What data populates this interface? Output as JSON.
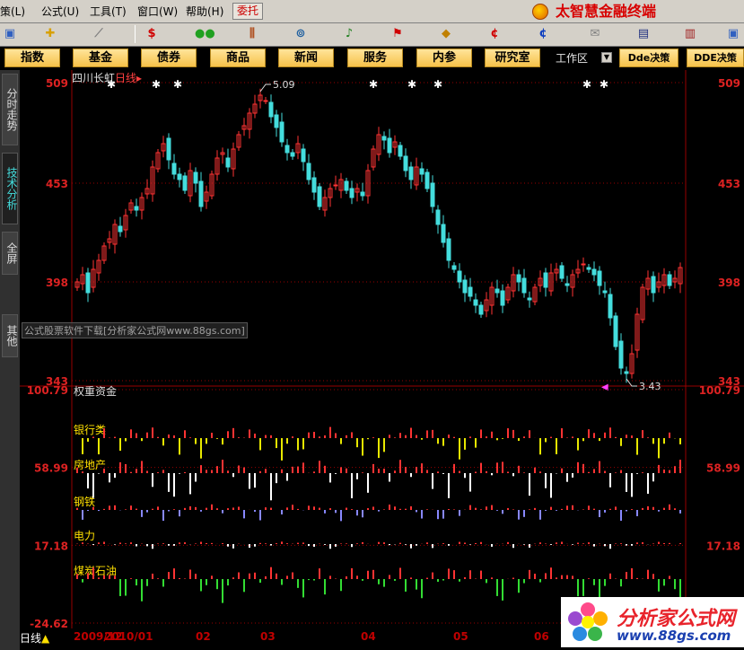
{
  "menubar": {
    "items": [
      "策(L)",
      "公式(U)",
      "工具(T)",
      "窗口(W)",
      "帮助(H)"
    ],
    "entrust": "委托",
    "brand": "太智慧金融终端"
  },
  "toolbar": {
    "icons": [
      "plus-icon",
      "ruler-icon",
      "dollar-icon",
      "traffic-light-icon",
      "bars-icon",
      "binoculars-icon",
      "bell-icon",
      "flag-icon",
      "diamond-icon",
      "red-coin-icon",
      "blue-coin-icon",
      "envelope-icon",
      "window-icon",
      "books-icon"
    ]
  },
  "nav": {
    "buttons": [
      "指数",
      "基金",
      "债券",
      "商品",
      "新闻",
      "服务",
      "内参",
      "研究室"
    ],
    "workarea": "工作区",
    "dde1": "Dde决策",
    "dde2": "DDE决策"
  },
  "sidebar": {
    "tabs": [
      "分时走势",
      "技术分析",
      "全屏",
      "其他"
    ]
  },
  "stock": {
    "name": "四川长虹",
    "period": "日线",
    "high_label": "5.09",
    "low_label": "3.43",
    "price_levels": [
      "509",
      "453",
      "398",
      "343"
    ]
  },
  "indicator": {
    "title": "权重资金",
    "levels": [
      "100.79",
      "58.99",
      "17.18",
      "-24.62"
    ],
    "series": [
      {
        "name": "银行类",
        "color": "#e8e800"
      },
      {
        "name": "房地产",
        "color": "#ffffff"
      },
      {
        "name": "钢铁",
        "color": "#8888ff"
      },
      {
        "name": "电力",
        "color": "#ffffff"
      },
      {
        "name": "煤炭石油",
        "color": "#33dd33"
      }
    ]
  },
  "xaxis": {
    "period_label": "日线",
    "ticks": [
      "2009/12",
      "2010/01",
      "02",
      "03",
      "04",
      "05",
      "06"
    ]
  },
  "watermark": "公式股票软件下载[分析家公式网www.88gs.com]",
  "logo": {
    "line1": "分析家公式网",
    "line2": "www.88gs.com"
  },
  "colors": {
    "up": "#ff3333",
    "down": "#44dddd",
    "grid": "#990000",
    "axis_text": "#dd2222"
  },
  "chart_data": {
    "type": "candlestick",
    "title": "四川长虹 日线",
    "ylim": [
      3.43,
      5.09
    ],
    "price_axis": [
      5.09,
      4.53,
      3.98,
      3.43
    ],
    "closes": [
      3.98,
      4.02,
      3.92,
      4.05,
      4.1,
      4.18,
      4.22,
      4.3,
      4.26,
      4.35,
      4.42,
      4.38,
      4.45,
      4.5,
      4.62,
      4.7,
      4.75,
      4.66,
      4.58,
      4.55,
      4.49,
      4.6,
      4.53,
      4.4,
      4.48,
      4.58,
      4.67,
      4.7,
      4.62,
      4.72,
      4.8,
      4.85,
      4.92,
      4.97,
      5.02,
      4.99,
      4.9,
      4.84,
      4.76,
      4.7,
      4.68,
      4.75,
      4.65,
      4.55,
      4.48,
      4.4,
      4.45,
      4.5,
      4.52,
      4.55,
      4.49,
      4.45,
      4.5,
      4.46,
      4.6,
      4.72,
      4.8,
      4.77,
      4.7,
      4.76,
      4.68,
      4.6,
      4.55,
      4.62,
      4.58,
      4.5,
      4.4,
      4.3,
      4.2,
      4.1,
      4.05,
      3.98,
      3.92,
      3.9,
      3.85,
      3.8,
      3.88,
      3.95,
      3.92,
      3.85,
      3.95,
      4.02,
      3.98,
      3.92,
      3.88,
      3.95,
      4.0,
      3.95,
      4.03,
      4.05,
      4.0,
      3.96,
      4.02,
      4.05,
      4.08,
      4.05,
      4.02,
      3.96,
      3.92,
      3.78,
      3.62,
      3.5,
      3.47,
      3.58,
      3.8,
      3.95,
      4.0,
      3.92,
      3.98,
      4.02,
      3.96,
      4.0,
      4.06
    ],
    "indicator_ylim": [
      -24.62,
      100.79
    ],
    "indicator_axis": [
      100.79,
      58.99,
      17.18,
      -24.62
    ]
  }
}
